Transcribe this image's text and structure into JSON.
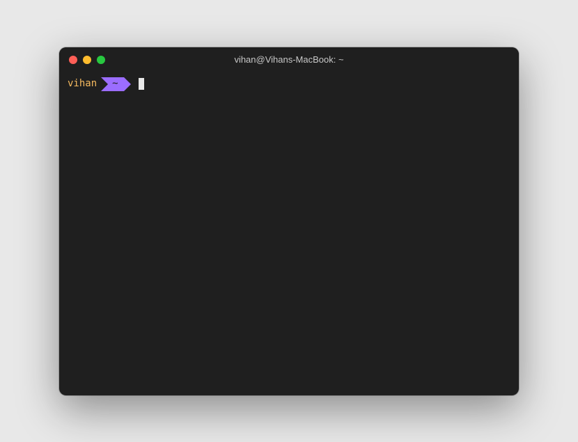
{
  "titlebar": {
    "title": "vihan@Vihans-MacBook: ~"
  },
  "prompt": {
    "user": "vihan",
    "directory": "~",
    "command": ""
  }
}
